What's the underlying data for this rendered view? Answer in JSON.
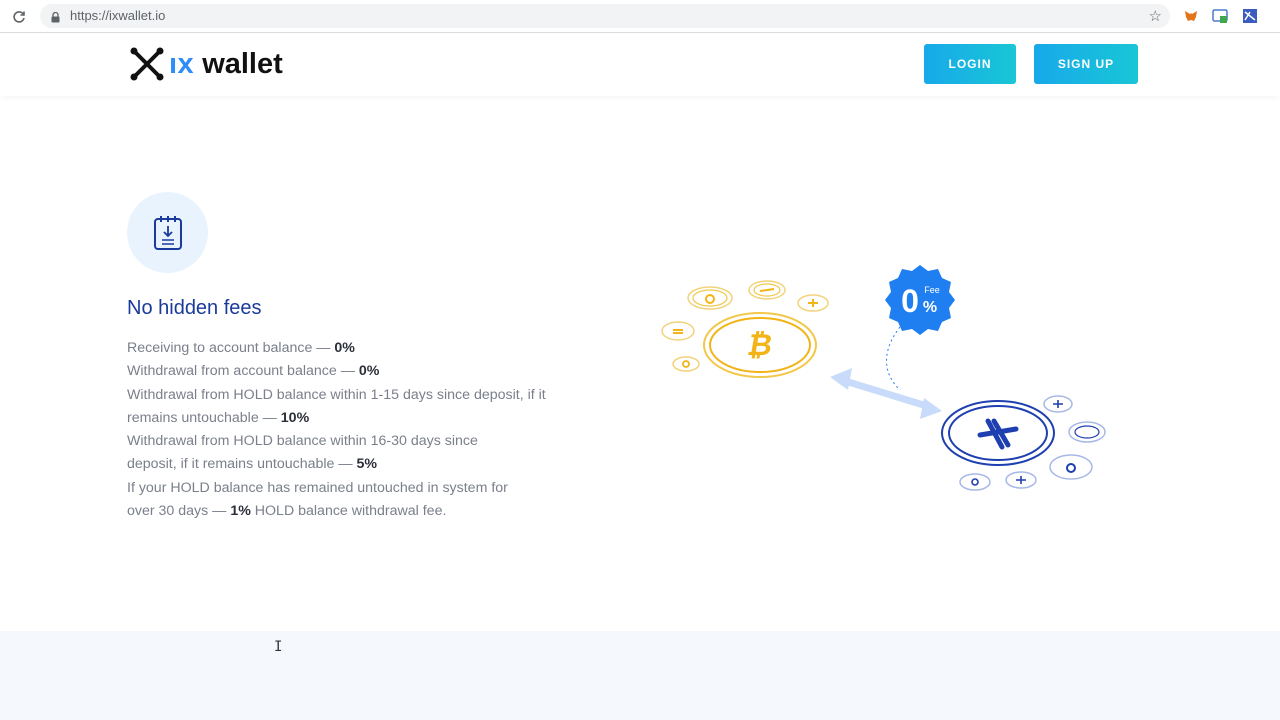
{
  "browser": {
    "url": "https://ixwallet.io"
  },
  "header": {
    "logo_prefix": "ıx",
    "logo_suffix": "wallet",
    "login_label": "LOGIN",
    "signup_label": "SIGN UP"
  },
  "section": {
    "title": "No hidden fees",
    "items": [
      {
        "text": "Receiving to account balance — ",
        "value": "0%"
      },
      {
        "text": "Withdrawal from account balance — ",
        "value": "0%"
      },
      {
        "text": "Withdrawal from HOLD balance within 1-15 days since deposit, if it remains untouchable — ",
        "value": "10%"
      },
      {
        "text": "Withdrawal from HOLD balance within 16-30 days since deposit, if it remains untouchable — ",
        "value": "5%"
      },
      {
        "text": "If your HOLD balance has remained untouched in system for over 30 days — ",
        "value": "1%",
        "after": " HOLD balance withdrawal fee."
      }
    ]
  },
  "illustration": {
    "badge_number": "0",
    "badge_fee": "Fee",
    "badge_percent": "%"
  },
  "colors": {
    "brand_blue": "#2f8dfb",
    "title_blue": "#1a3a9c",
    "button_start": "#17a9ea",
    "button_end": "#19c6d6",
    "coin_gold": "#f2b416",
    "coin_navy": "#1e3fb0"
  },
  "icons": [
    "reload-icon",
    "lock-icon",
    "star-icon",
    "metamask-extension-icon",
    "screenshot-extension-icon",
    "extension-icon",
    "document-icon",
    "bitcoin-coin-icon",
    "ix-coin-icon",
    "exchange-arrows-icon",
    "fee-badge-icon"
  ]
}
